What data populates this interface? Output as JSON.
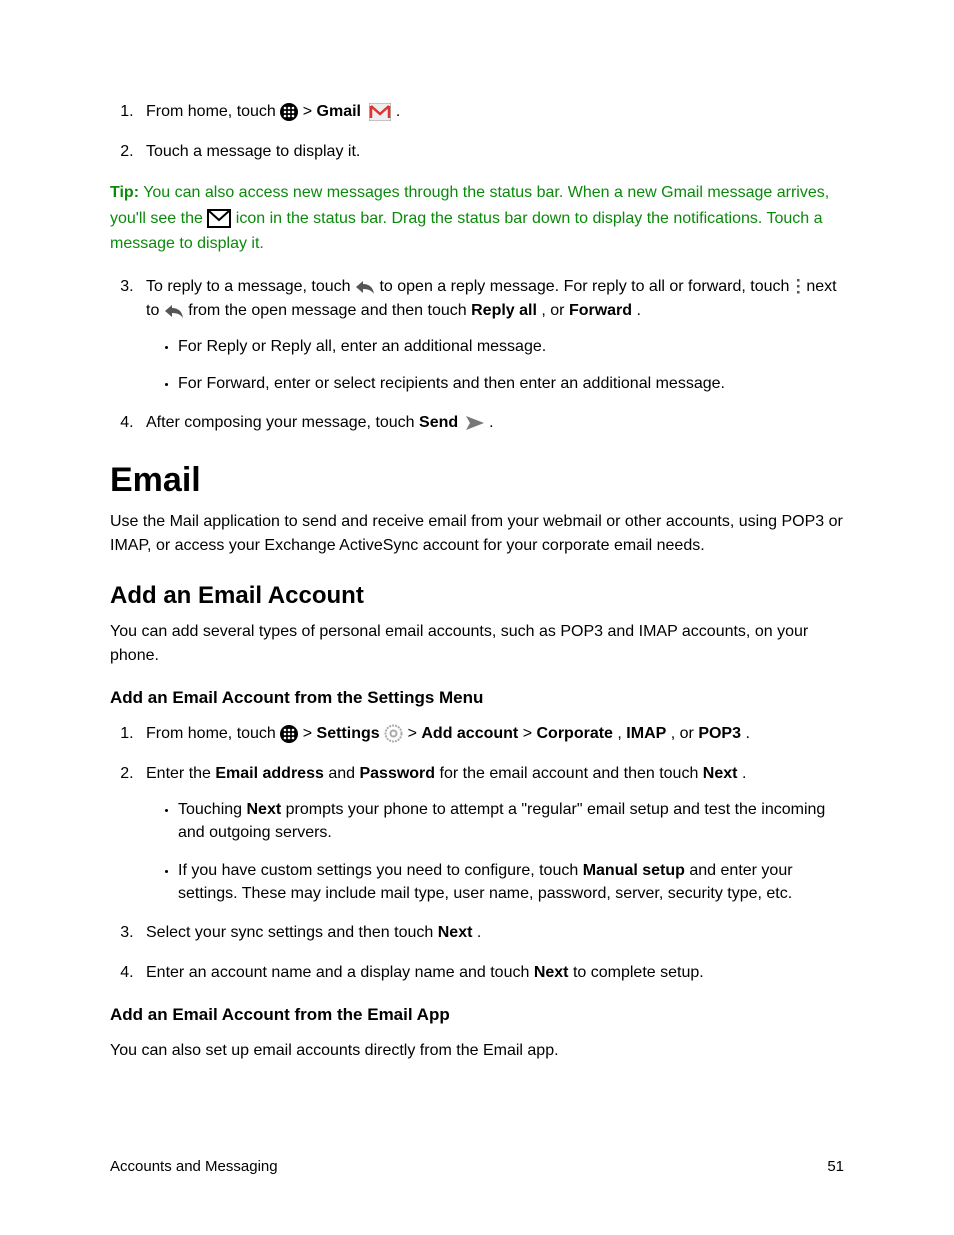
{
  "list1": {
    "item1_a": "From home, touch ",
    "item1_b": " > ",
    "item1_gmail": "Gmail",
    "item1_c": " .",
    "item2": "Touch a message to display it."
  },
  "tip": {
    "label": "Tip:",
    "text_a": " You can also access new messages through the status bar. When a new Gmail message arrives, you'll see the ",
    "text_b": " icon in the status bar. Drag the status bar down to display the notifications. Touch a message to display it."
  },
  "list2": {
    "item3_a": "To reply to a message, touch ",
    "item3_b": " to open a reply message. For reply to all or forward, touch ",
    "item3_c": " next to ",
    "item3_d": " from the open message and then touch ",
    "item3_reply_all": "Reply all",
    "item3_e": ", or ",
    "item3_forward": "Forward",
    "item3_f": ".",
    "sub1": "For Reply or Reply all, enter an additional message.",
    "sub2": "For Forward, enter or select recipients and then enter an additional message.",
    "item4_a": "After composing your message, touch ",
    "item4_send": "Send",
    "item4_b": " ."
  },
  "h1": "Email",
  "p1": "Use the Mail application to send and receive email from your webmail or other accounts, using POP3 or IMAP, or access your Exchange ActiveSync account for your corporate email needs.",
  "h2": "Add an Email Account",
  "p2": "You can add several types of personal email accounts, such as POP3 and IMAP accounts, on your phone.",
  "h3a": "Add an Email Account from the Settings Menu",
  "list3": {
    "item1_a": "From home, touch ",
    "item1_b": " > ",
    "item1_settings": "Settings",
    "item1_c": " ",
    "item1_d": " > ",
    "item1_addacct": "Add account",
    "item1_e": " > ",
    "item1_corp": "Corporate",
    "item1_f": ", ",
    "item1_imap": "IMAP",
    "item1_g": ", or ",
    "item1_pop3": "POP3",
    "item1_h": ".",
    "item2_a": "Enter the ",
    "item2_email": "Email address",
    "item2_b": " and ",
    "item2_pwd": "Password",
    "item2_c": " for the email account and then touch ",
    "item2_next": "Next",
    "item2_d": ".",
    "sub1_a": "Touching ",
    "sub1_next": "Next",
    "sub1_b": " prompts your phone to attempt a \"regular\" email setup and test the incoming and outgoing servers.",
    "sub2_a": "If you have custom settings you need to configure, touch ",
    "sub2_manual": "Manual setup",
    "sub2_b": " and enter your settings. These may include mail type, user name, password, server, security type, etc.",
    "item3_a": "Select your sync settings and then touch ",
    "item3_next": "Next",
    "item3_b": ".",
    "item4_a": "Enter an account name and a display name and touch ",
    "item4_next": "Next",
    "item4_b": " to complete setup."
  },
  "h3b": "Add an Email Account from the Email App",
  "p3": "You can also set up email accounts directly from the Email app.",
  "footer": {
    "left": "Accounts and Messaging",
    "right": "51"
  }
}
